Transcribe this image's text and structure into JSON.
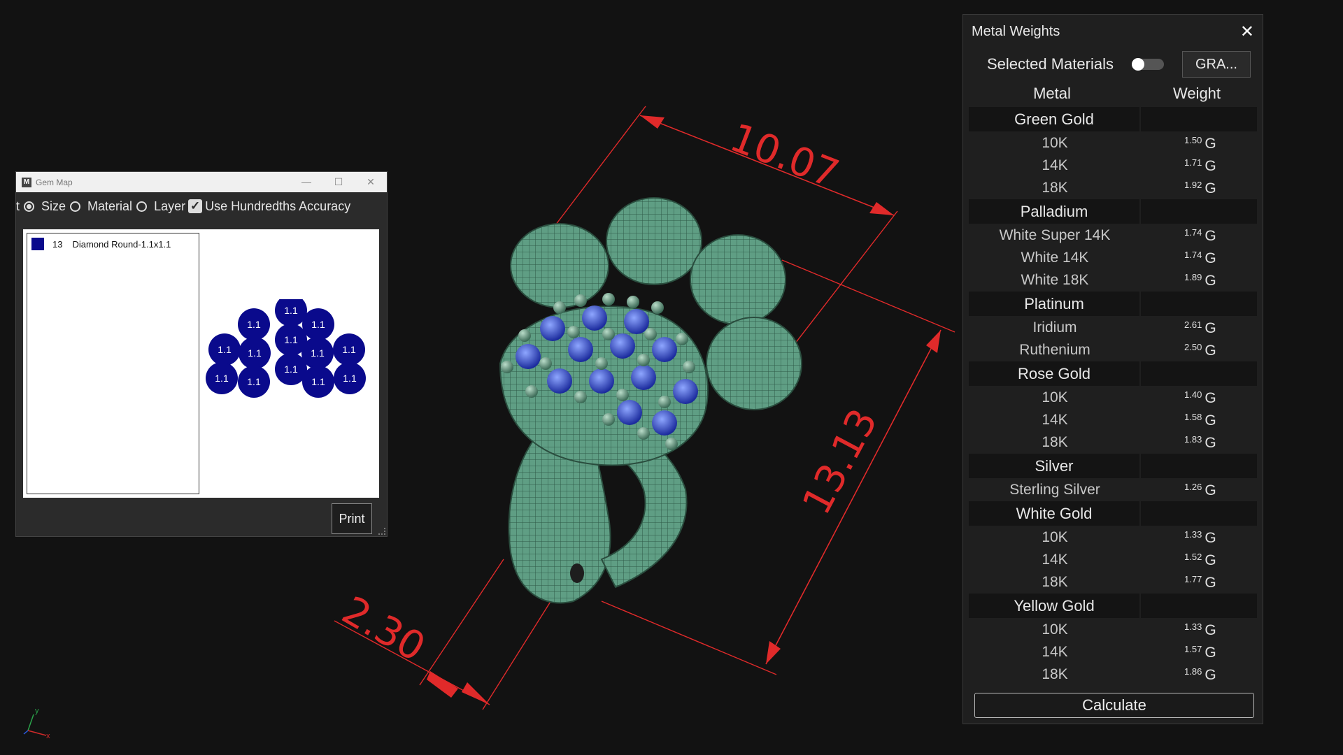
{
  "viewport": {
    "dimensions": [
      "10.07",
      "13.13",
      "2.30"
    ],
    "axis_labels": {
      "x": "x",
      "y": "y"
    },
    "colors": {
      "dimension": "#e02a2a",
      "metal": "#5f9e84",
      "gem": "#1e2fa8"
    }
  },
  "gem_map": {
    "title": "Gem Map",
    "app_icon": "M",
    "options": {
      "partial_label": "t",
      "size_label": "Size",
      "material_label": "Material",
      "layer_label": "Layer",
      "accuracy_label": "Use Hundredths Accuracy",
      "selected": "size",
      "accuracy_checked": true
    },
    "list": [
      {
        "count": "13",
        "name": "Diamond Round-1.1x1.1",
        "color": "#0a0a8c"
      }
    ],
    "gem_label": "1.1",
    "print_label": "Print"
  },
  "metal_weights": {
    "title": "Metal Weights",
    "selected_materials_label": "Selected Materials",
    "selected_materials_on": false,
    "gra_label": "GRA...",
    "col_metal": "Metal",
    "col_weight": "Weight",
    "unit": "G",
    "groups": [
      {
        "name": "Green Gold",
        "items": [
          {
            "name": "10K",
            "w": "1.50"
          },
          {
            "name": "14K",
            "w": "1.71"
          },
          {
            "name": "18K",
            "w": "1.92"
          }
        ]
      },
      {
        "name": "Palladium",
        "items": [
          {
            "name": "White Super 14K",
            "w": "1.74"
          },
          {
            "name": "White 14K",
            "w": "1.74"
          },
          {
            "name": "White 18K",
            "w": "1.89"
          }
        ]
      },
      {
        "name": "Platinum",
        "items": [
          {
            "name": "Iridium",
            "w": "2.61"
          },
          {
            "name": "Ruthenium",
            "w": "2.50"
          }
        ]
      },
      {
        "name": "Rose Gold",
        "items": [
          {
            "name": "10K",
            "w": "1.40"
          },
          {
            "name": "14K",
            "w": "1.58"
          },
          {
            "name": "18K",
            "w": "1.83"
          }
        ]
      },
      {
        "name": "Silver",
        "items": [
          {
            "name": "Sterling Silver",
            "w": "1.26"
          }
        ]
      },
      {
        "name": "White Gold",
        "items": [
          {
            "name": "10K",
            "w": "1.33"
          },
          {
            "name": "14K",
            "w": "1.52"
          },
          {
            "name": "18K",
            "w": "1.77"
          }
        ]
      },
      {
        "name": "Yellow Gold",
        "items": [
          {
            "name": "10K",
            "w": "1.33"
          },
          {
            "name": "14K",
            "w": "1.57"
          },
          {
            "name": "18K",
            "w": "1.86"
          }
        ]
      }
    ],
    "calculate_label": "Calculate"
  }
}
